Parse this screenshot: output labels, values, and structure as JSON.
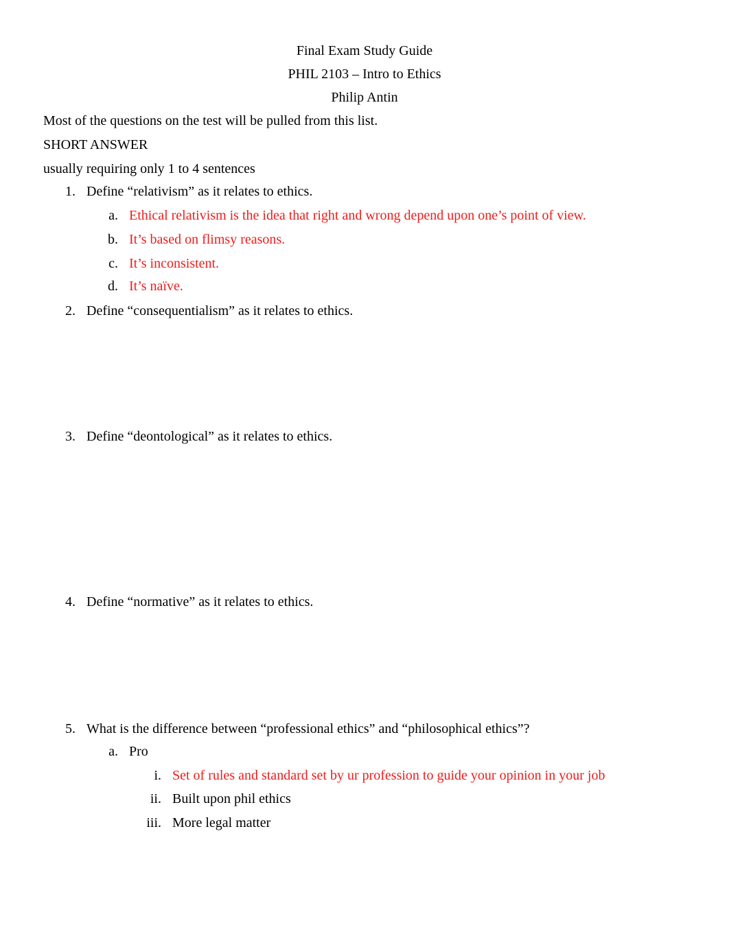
{
  "header": {
    "title": "Final Exam Study Guide",
    "course": "PHIL 2103 – Intro to Ethics",
    "instructor": "Philip Antin"
  },
  "intro": "Most of the questions on the test will be pulled from this list.",
  "section": {
    "heading": "SHORT ANSWER",
    "subheading": "usually requiring only 1 to 4  sentences"
  },
  "questions": [
    {
      "number": "1.",
      "text": "Define “relativism” as it relates to ethics.",
      "answers": [
        {
          "marker": "a.",
          "text": "Ethical relativism is the idea that right and wrong depend upon one’s point of view.",
          "color": "#ee1c1c"
        },
        {
          "marker": "b.",
          "text": "It’s based on flimsy reasons.",
          "color": "#ee1c1c"
        },
        {
          "marker": "c.",
          "text": "It’s inconsistent.",
          "color": "#ee1c1c"
        },
        {
          "marker": "d.",
          "text": "It’s naïve.",
          "color": "#ee1c1c"
        }
      ]
    },
    {
      "number": "2.",
      "text": "Define “consequentialism” as it relates to ethics."
    },
    {
      "number": "3.",
      "text": "Define “deontological” as it relates to ethics."
    },
    {
      "number": "4.",
      "text": "Define “normative” as it relates to ethics."
    },
    {
      "number": "5.",
      "text": "What is the difference between “professional ethics” and “philosophical ethics”?",
      "answers": [
        {
          "marker": "a.",
          "text": "Pro",
          "sub": [
            {
              "marker": "i.",
              "text": "Set of rules and standard set by ur profession to guide your opinion in your job",
              "color": "#ee1c1c"
            },
            {
              "marker": "ii.",
              "text": "Built upon phil ethics"
            },
            {
              "marker": "iii.",
              "text": "More legal matter"
            }
          ]
        }
      ]
    }
  ]
}
